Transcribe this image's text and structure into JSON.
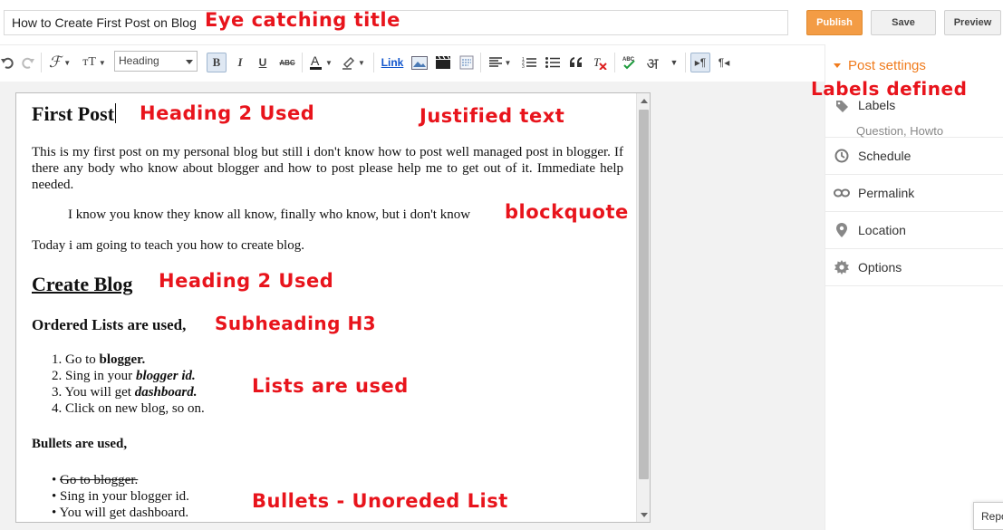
{
  "post_title": "How to Create First Post on Blog",
  "buttons": {
    "publish": "Publish",
    "save": "Save",
    "preview": "Preview"
  },
  "toolbar": {
    "heading_select": "Heading",
    "bold": "B",
    "italic": "I",
    "underline": "U",
    "strike": "ABC",
    "link": "Link",
    "transliterate": "अ",
    "icons": [
      "undo-icon",
      "redo-icon",
      "font-family-icon",
      "font-size-icon",
      "bold-icon",
      "italic-icon",
      "underline-icon",
      "strikethrough-icon",
      "text-color-icon",
      "highlight-color-icon",
      "link-icon",
      "image-icon",
      "video-icon",
      "jump-break-icon",
      "align-icon",
      "numbered-list-icon",
      "bullet-list-icon",
      "quote-icon",
      "clear-format-icon",
      "spellcheck-icon",
      "transliterate-icon",
      "ltr-icon",
      "rtl-icon"
    ]
  },
  "editor": {
    "h_first_post": "First Post",
    "intro_paragraph": "This is my first post on my personal blog but still i don't know how to post well managed post in blogger. If there any body who know about blogger and how to post please help me to get out of it. Immediate help needed.",
    "blockquote": "I know you know they know all know, finally who know, but i don't know",
    "today_line": "Today i am going to teach you how to create blog.",
    "h_create_blog": "Create Blog",
    "h_ordered": "Ordered Lists are used,",
    "ordered_list": [
      {
        "num": "1.",
        "pre": "Go to ",
        "em": "blogger."
      },
      {
        "num": "2.",
        "pre": "Sing in your ",
        "em": "blogger id."
      },
      {
        "num": "3.",
        "pre": "You will get ",
        "em": "dashboard."
      },
      {
        "num": "4.",
        "pre": "Click on new blog, so on.",
        "em": ""
      }
    ],
    "h_bullets": "Bullets are used,",
    "bullet_list": [
      "Go to blogger.",
      "Sing in your blogger id.",
      "You will get dashboard."
    ]
  },
  "annotations": {
    "title": "Eye catching title",
    "heading1": "Heading 2 Used",
    "justified": "Justified text",
    "blockquote": "blockquote",
    "heading2": "Heading 2 Used",
    "subheading": "Subheading H3",
    "lists": "Lists are used",
    "bullets": "Bullets - Unoreded List",
    "labels": "Labels defined"
  },
  "sidebar": {
    "header": "Post settings",
    "labels_label": "Labels",
    "labels_value": "Question, Howto",
    "schedule": "Schedule",
    "permalink": "Permalink",
    "location": "Location",
    "options": "Options"
  },
  "report_label": "Repo",
  "colors": {
    "accent": "#f07b1c",
    "publish": "#f39c45",
    "annotation": "#e8141c"
  }
}
